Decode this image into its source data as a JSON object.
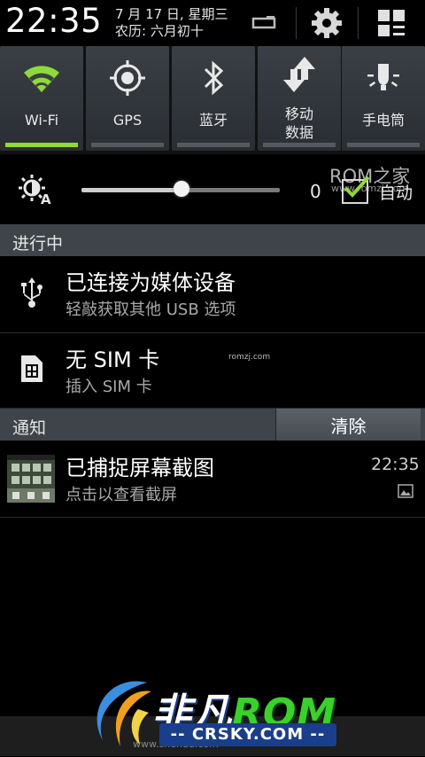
{
  "status": {
    "clock": "22:35",
    "date_line1": "7 月 17 日, 星期三",
    "date_line2": "农历: 六月初十",
    "icons": [
      "screen-rotation-icon",
      "settings-gear-icon",
      "grid-toggle-icon"
    ]
  },
  "toggles": [
    {
      "label": "Wi-Fi",
      "icon": "wifi-icon",
      "on": true
    },
    {
      "label": "GPS",
      "icon": "gps-icon",
      "on": false
    },
    {
      "label": "蓝牙",
      "icon": "bluetooth-icon",
      "on": false
    },
    {
      "label": "移动\n数据",
      "label1": "移动",
      "label2": "数据",
      "icon": "mobile-data-icon",
      "on": false
    },
    {
      "label": "手电筒",
      "icon": "flashlight-icon",
      "on": false
    }
  ],
  "brightness": {
    "value": "0",
    "level": 0.5,
    "auto_label": "自动",
    "watermark1": "ROM之家",
    "watermark2": "www.romzj.com"
  },
  "ongoing": {
    "header": "进行中",
    "items": [
      {
        "title": "已连接为媒体设备",
        "subtitle": "轻敲获取其他 USB 选项",
        "icon": "usb-icon"
      },
      {
        "title": "无 SIM 卡",
        "subtitle": "插入 SIM 卡",
        "icon": "sim-card-icon",
        "watermark": "romzj.com"
      }
    ]
  },
  "notifications": {
    "header": "通知",
    "clear_label": "清除",
    "items": [
      {
        "title": "已捕捉屏幕截图",
        "subtitle": "点击以查看截屏",
        "time": "22:35",
        "icon": "gallery-icon"
      }
    ]
  },
  "branding": {
    "logo_text_a": "非凡",
    "logo_text_b": "ROM",
    "logo_sub": "-- CRSKY.COM --",
    "bottom_text": "www.shendu.com"
  },
  "colors": {
    "accent_green": "#8fd93a",
    "section_bg": "#3e4449"
  }
}
